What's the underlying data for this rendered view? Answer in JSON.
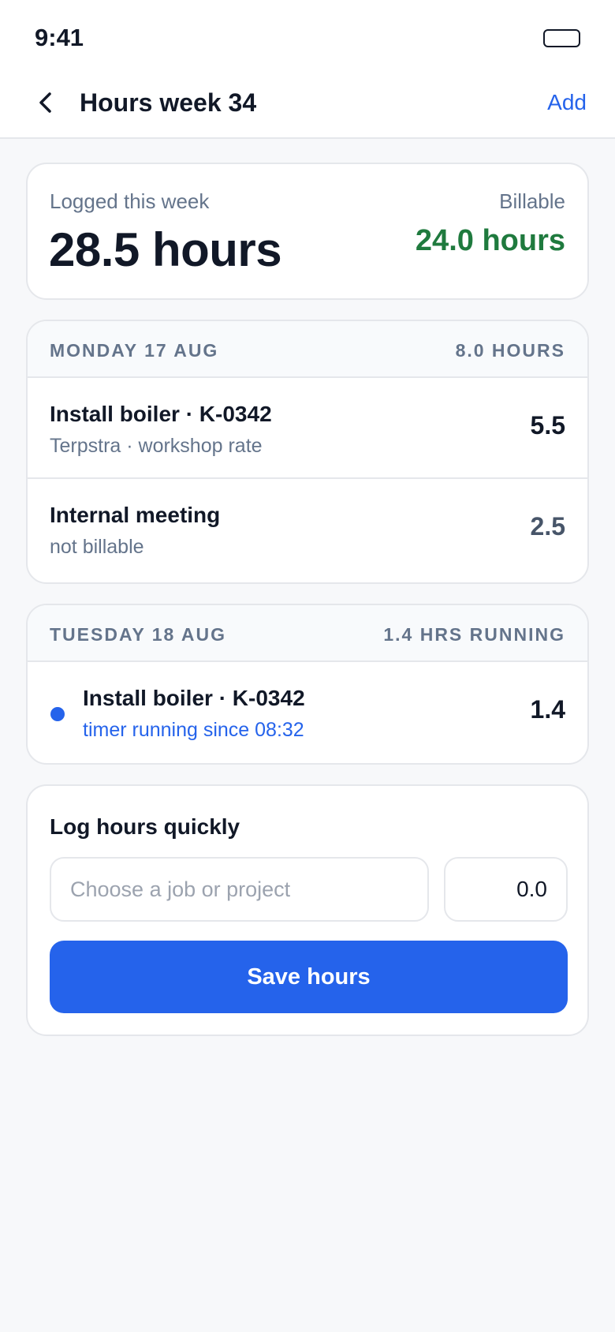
{
  "status_bar": {
    "time": "9:41"
  },
  "nav": {
    "title": "Hours week 34",
    "action": "Add"
  },
  "summary": {
    "logged_label": "Logged this week",
    "logged_value": "28.5 hours",
    "billable_label": "Billable",
    "billable_value": "24.0 hours"
  },
  "days": [
    {
      "title": "MONDAY 17 AUG",
      "total": "8.0 HOURS",
      "entries": [
        {
          "title": "Install boiler · K-0342",
          "subtitle": "Terpstra · workshop rate",
          "hours": "5.5"
        },
        {
          "title": "Internal meeting",
          "subtitle": "not billable",
          "hours": "2.5"
        }
      ]
    },
    {
      "title": "TUESDAY 18 AUG",
      "total": "1.4 HRS RUNNING",
      "entries": [
        {
          "title": "Install boiler · K-0342",
          "subtitle": "timer running since 08:32",
          "hours": "1.4"
        }
      ]
    }
  ],
  "quick_log": {
    "title": "Log hours quickly",
    "job_placeholder": "Choose a job or project",
    "hours_value": "0.0",
    "save_label": "Save hours"
  },
  "colors": {
    "accent": "#2563EB",
    "billable": "#1F7A3E",
    "muted": "#64748B",
    "background": "#F7F8FA"
  },
  "icons": {
    "back": "chevron-left-icon",
    "running": "dot-icon",
    "battery": "battery-icon"
  }
}
